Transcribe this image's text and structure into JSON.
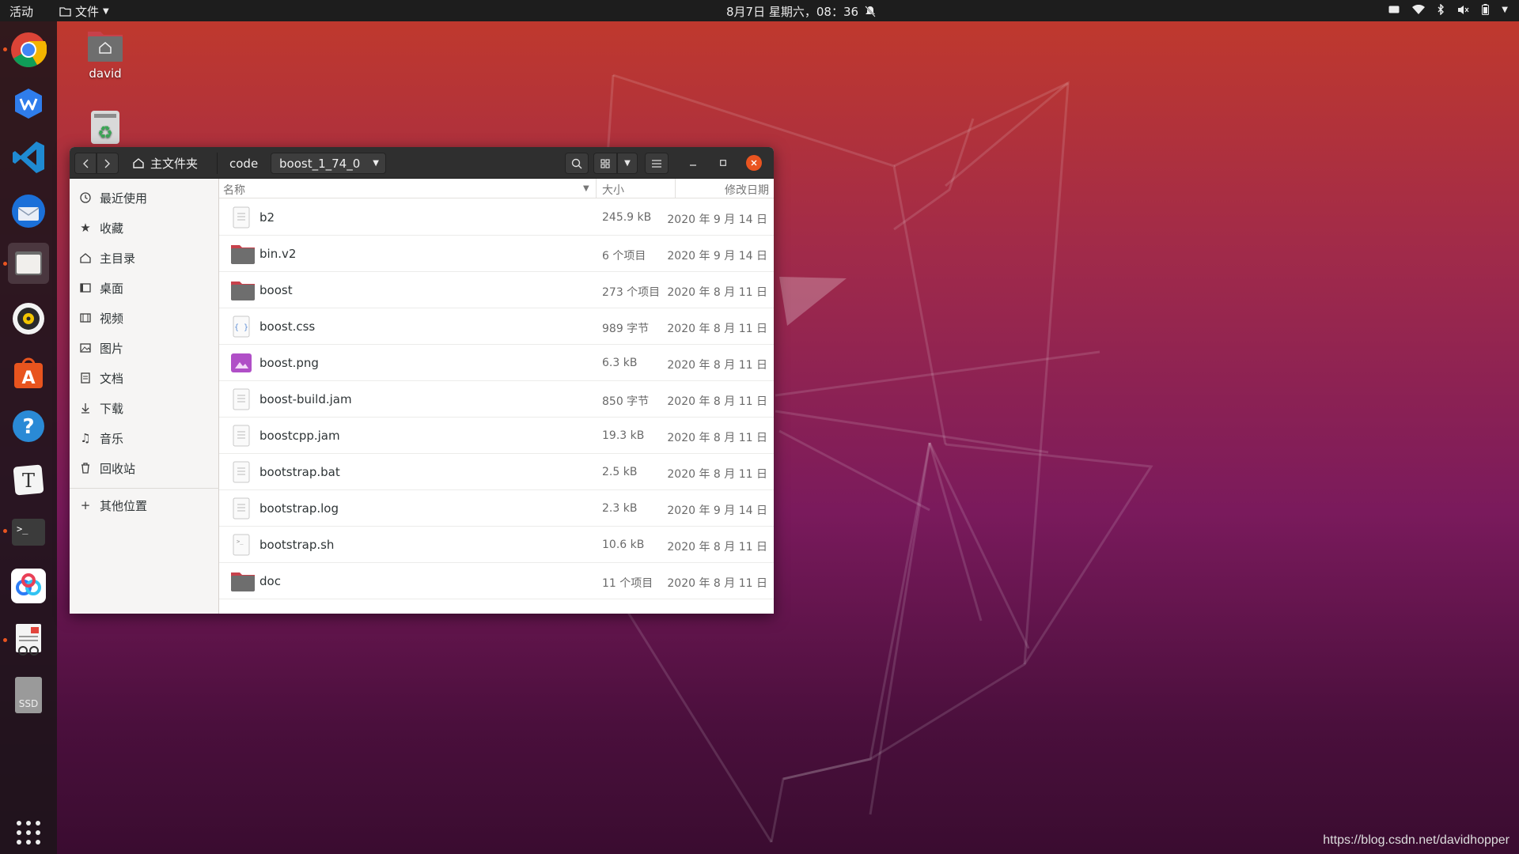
{
  "topbar": {
    "activities": "活动",
    "app_menu": "文件",
    "clock": "8月7日 星期六，08：36"
  },
  "desktop": {
    "home_label": "david"
  },
  "dock": [
    "chrome-icon",
    "wps-icon",
    "vscode-icon",
    "thunderbird-icon",
    "files-icon",
    "rhythmbox-icon",
    "software-icon",
    "help-icon",
    "typora-icon",
    "terminal-icon",
    "baidu-netdisk-icon",
    "reader-icon",
    "ssd-icon"
  ],
  "dock_ssd_label": "SSD",
  "window": {
    "breadcrumb": {
      "home": "主文件夹",
      "code": "code",
      "current": "boost_1_74_0"
    },
    "sidebar": {
      "recent": "最近使用",
      "starred": "收藏",
      "home": "主目录",
      "desktop": "桌面",
      "videos": "视频",
      "pictures": "图片",
      "documents": "文档",
      "downloads": "下载",
      "music": "音乐",
      "trash": "回收站",
      "other": "其他位置"
    },
    "columns": {
      "name": "名称",
      "size": "大小",
      "modified": "修改日期"
    },
    "files": [
      {
        "name": "b2",
        "size": "245.9 kB",
        "date": "2020 年 9 月 14 日",
        "type": "text"
      },
      {
        "name": "bin.v2",
        "size": "6 个项目",
        "date": "2020 年 9 月 14 日",
        "type": "folder"
      },
      {
        "name": "boost",
        "size": "273 个项目",
        "date": "2020 年 8 月 11 日",
        "type": "folder"
      },
      {
        "name": "boost.css",
        "size": "989 字节",
        "date": "2020 年 8 月 11 日",
        "type": "css"
      },
      {
        "name": "boost.png",
        "size": "6.3 kB",
        "date": "2020 年 8 月 11 日",
        "type": "image"
      },
      {
        "name": "boost-build.jam",
        "size": "850 字节",
        "date": "2020 年 8 月 11 日",
        "type": "text"
      },
      {
        "name": "boostcpp.jam",
        "size": "19.3 kB",
        "date": "2020 年 8 月 11 日",
        "type": "text"
      },
      {
        "name": "bootstrap.bat",
        "size": "2.5 kB",
        "date": "2020 年 8 月 11 日",
        "type": "text"
      },
      {
        "name": "bootstrap.log",
        "size": "2.3 kB",
        "date": "2020 年 9 月 14 日",
        "type": "text"
      },
      {
        "name": "bootstrap.sh",
        "size": "10.6 kB",
        "date": "2020 年 8 月 11 日",
        "type": "script"
      },
      {
        "name": "doc",
        "size": "11 个项目",
        "date": "2020 年 8 月 11 日",
        "type": "folder"
      }
    ]
  },
  "watermark": "https://blog.csdn.net/davidhopper",
  "colors": {
    "accent": "#e95420",
    "folder": "#6e6e6e",
    "folder_tab": "#c7414b",
    "image": "#b04fc7"
  }
}
